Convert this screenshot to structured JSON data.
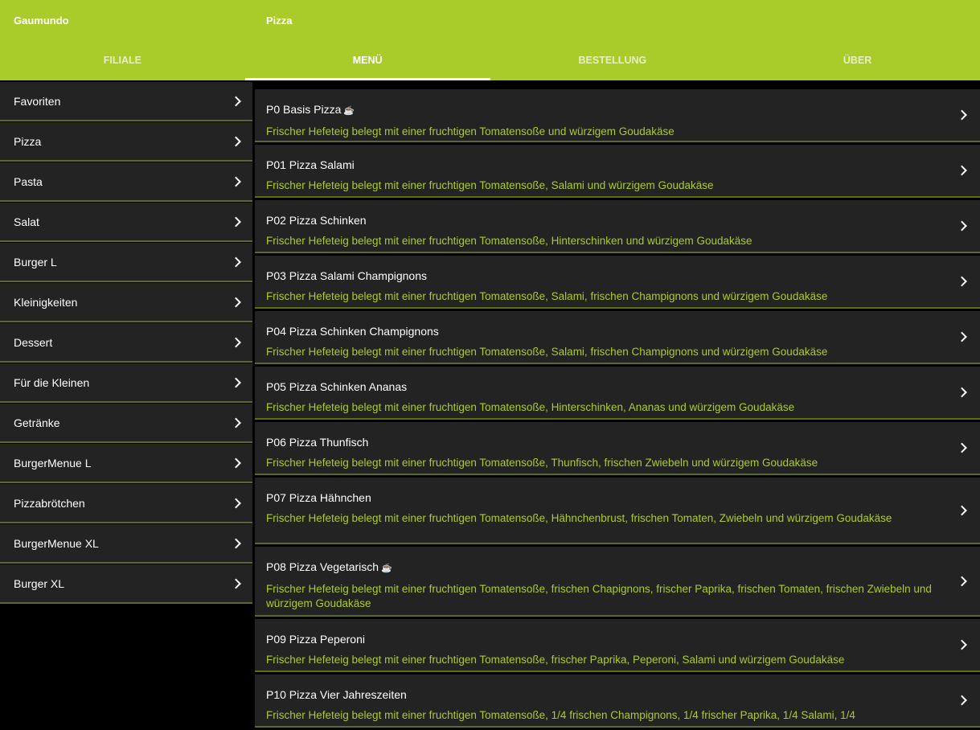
{
  "appbar": {
    "app_title": "Gaumundo",
    "page_title": "Pizza",
    "tabs": [
      {
        "label": "FILIALE"
      },
      {
        "label": "MENÜ"
      },
      {
        "label": "BESTELLUNG"
      },
      {
        "label": "ÜBER"
      }
    ],
    "active_tab": "MENÜ"
  },
  "sidebar": {
    "categories": [
      {
        "label": "Favoriten"
      },
      {
        "label": "Pizza"
      },
      {
        "label": "Pasta"
      },
      {
        "label": "Salat"
      },
      {
        "label": "Burger L"
      },
      {
        "label": "Kleinigkeiten"
      },
      {
        "label": "Dessert"
      },
      {
        "label": "Für die Kleinen"
      },
      {
        "label": "Getränke"
      },
      {
        "label": "BurgerMenue L"
      },
      {
        "label": "Pizzabrötchen"
      },
      {
        "label": "BurgerMenue XL"
      },
      {
        "label": "Burger XL"
      }
    ]
  },
  "menu_items": [
    {
      "name": "P0 Basis Pizza",
      "veg_icon": "☕",
      "desc": "Frischer Hefeteig belegt mit einer fruchtigen Tomatensoße und würzigem Goudakäse"
    },
    {
      "name": "P01 Pizza Salami",
      "desc": "Frischer Hefeteig belegt mit einer fruchtigen Tomatensoße, Salami und würzigem Goudakäse"
    },
    {
      "name": "P02 Pizza Schinken",
      "desc": "Frischer Hefeteig belegt mit einer fruchtigen Tomatensoße, Hinterschinken und würzigem Goudakäse"
    },
    {
      "name": "P03 Pizza Salami Champignons",
      "desc": "Frischer Hefeteig belegt mit einer fruchtigen Tomatensoße, Salami, frischen Champignons und würzigem Goudakäse"
    },
    {
      "name": "P04 Pizza Schinken Champignons",
      "desc": "Frischer Hefeteig belegt mit einer fruchtigen Tomatensoße, Salami, frischen Champignons und würzigem Goudakäse"
    },
    {
      "name": "P05 Pizza Schinken Ananas",
      "desc": "Frischer Hefeteig belegt mit einer fruchtigen Tomatensoße, Hinterschinken, Ananas und würzigem Goudakäse"
    },
    {
      "name": "P06 Pizza Thunfisch",
      "desc": "Frischer Hefeteig belegt mit einer fruchtigen Tomatensoße, Thunfisch, frischen Zwiebeln  und würzigem Goudakäse"
    },
    {
      "name": "P07 Pizza Hähnchen",
      "desc": "Frischer Hefeteig belegt mit einer fruchtigen Tomatensoße, Hähnchenbrust, frischen Tomaten, Zwiebeln und würzigem Goudakäse"
    },
    {
      "name": "P08 Pizza Vegetarisch",
      "veg_icon": "☕",
      "desc": "Frischer Hefeteig belegt mit einer fruchtigen Tomatensoße, frischen Chapignons, frischer Paprika, frischen Tomaten, frischen Zwiebeln und würzigem Goudakäse"
    },
    {
      "name": "P09 Pizza Peperoni",
      "desc": "Frischer Hefeteig belegt mit einer fruchtigen Tomatensoße, frischer Paprika, Peperoni, Salami und würzigem Goudakäse"
    },
    {
      "name": "P10 Pizza Vier Jahreszeiten",
      "desc": "Frischer Hefeteig belegt mit einer fruchtigen Tomatensoße, 1/4 frischen Champignons, 1/4 frischer Paprika, 1/4 Salami, 1/4"
    }
  ],
  "colors": {
    "accent": "#a9cc2a",
    "panel": "#232323",
    "divider": "#5c6e14"
  }
}
